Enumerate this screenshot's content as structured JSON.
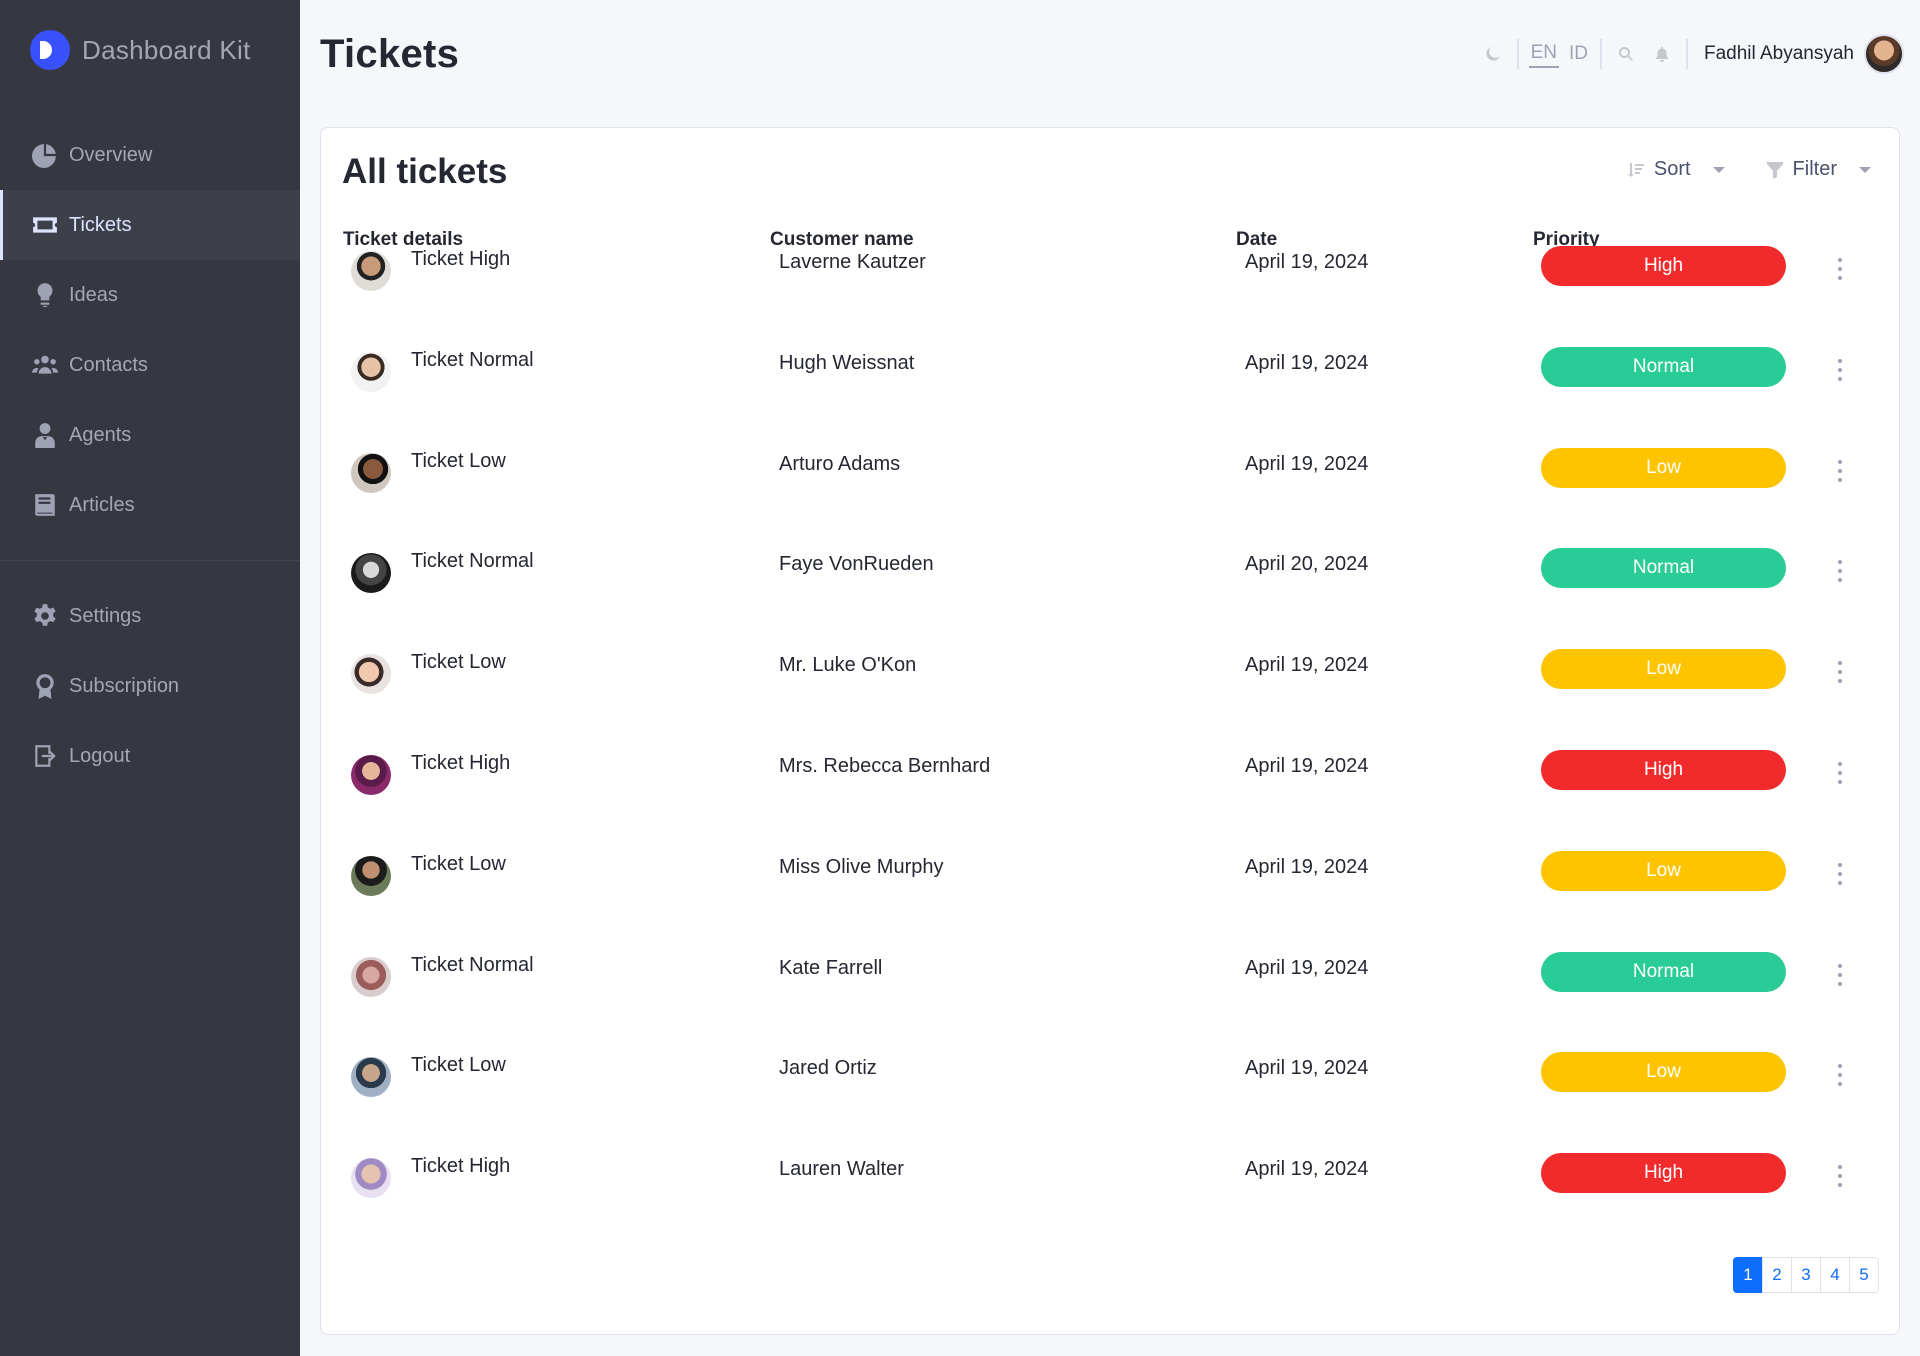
{
  "app": {
    "brand": "Dashboard Kit"
  },
  "nav": {
    "main": [
      {
        "label": "Overview",
        "icon": "pie-chart-icon"
      },
      {
        "label": "Tickets",
        "icon": "ticket-icon",
        "active": true
      },
      {
        "label": "Ideas",
        "icon": "lightbulb-icon"
      },
      {
        "label": "Contacts",
        "icon": "users-icon"
      },
      {
        "label": "Agents",
        "icon": "agent-icon"
      },
      {
        "label": "Articles",
        "icon": "book-icon"
      }
    ],
    "secondary": [
      {
        "label": "Settings",
        "icon": "gear-icon"
      },
      {
        "label": "Subscription",
        "icon": "badge-icon"
      },
      {
        "label": "Logout",
        "icon": "logout-icon"
      }
    ]
  },
  "header": {
    "title": "Tickets",
    "languages": [
      "EN",
      "ID"
    ],
    "active_language": "EN",
    "user_name": "Fadhil Abyansyah"
  },
  "card": {
    "title": "All tickets",
    "sort_label": "Sort",
    "filter_label": "Filter",
    "columns": [
      "Ticket details",
      "Customer name",
      "Date",
      "Priority"
    ]
  },
  "tickets": [
    {
      "title": "Ticket High",
      "customer": "Laverne Kautzer",
      "date": "April 19, 2024",
      "priority": "High"
    },
    {
      "title": "Ticket Normal",
      "customer": "Hugh Weissnat",
      "date": "April 19, 2024",
      "priority": "Normal"
    },
    {
      "title": "Ticket Low",
      "customer": "Arturo Adams",
      "date": "April 19, 2024",
      "priority": "Low"
    },
    {
      "title": "Ticket Normal",
      "customer": "Faye VonRueden",
      "date": "April 20, 2024",
      "priority": "Normal"
    },
    {
      "title": "Ticket Low",
      "customer": "Mr. Luke O'Kon",
      "date": "April 19, 2024",
      "priority": "Low"
    },
    {
      "title": "Ticket High",
      "customer": "Mrs. Rebecca Bernhard",
      "date": "April 19, 2024",
      "priority": "High"
    },
    {
      "title": "Ticket Low",
      "customer": "Miss Olive Murphy",
      "date": "April 19, 2024",
      "priority": "Low"
    },
    {
      "title": "Ticket Normal",
      "customer": "Kate Farrell",
      "date": "April 19, 2024",
      "priority": "Normal"
    },
    {
      "title": "Ticket Low",
      "customer": "Jared Ortiz",
      "date": "April 19, 2024",
      "priority": "Low"
    },
    {
      "title": "Ticket High",
      "customer": "Lauren Walter",
      "date": "April 19, 2024",
      "priority": "High"
    }
  ],
  "priority_colors": {
    "High": "#f12b2c",
    "Normal": "#29cc97",
    "Low": "#fec400"
  },
  "pagination": {
    "pages": [
      "1",
      "2",
      "3",
      "4",
      "5"
    ],
    "current": "1"
  }
}
